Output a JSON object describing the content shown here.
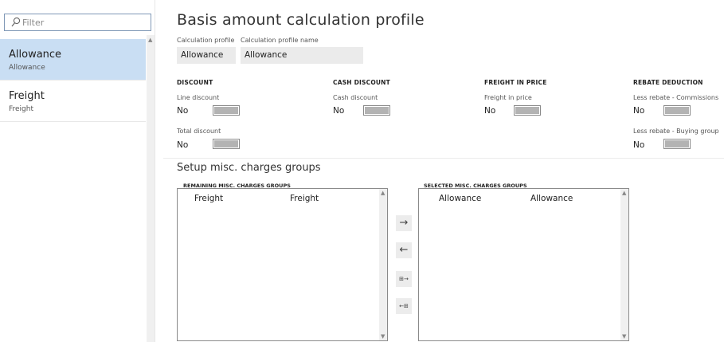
{
  "filter": {
    "placeholder": "Filter",
    "icon": "search-icon"
  },
  "list": [
    {
      "title": "Allowance",
      "subtitle": "Allowance",
      "selected": true
    },
    {
      "title": "Freight",
      "subtitle": "Freight",
      "selected": false
    }
  ],
  "page": {
    "title": "Basis amount calculation profile",
    "fields": {
      "profile_label": "Calculation profile",
      "profile_value": "Allowance",
      "name_label": "Calculation profile name",
      "name_value": "Allowance"
    }
  },
  "sections": {
    "discount": {
      "header": "DISCOUNT",
      "line_label": "Line discount",
      "line_value": "No",
      "total_label": "Total discount",
      "total_value": "No"
    },
    "cash_discount": {
      "header": "CASH DISCOUNT",
      "label": "Cash discount",
      "value": "No"
    },
    "freight": {
      "header": "FREIGHT IN PRICE",
      "label": "Freight in price",
      "value": "No"
    },
    "rebate": {
      "header": "REBATE DEDUCTION",
      "commissions_label": "Less rebate - Commissions",
      "commissions_value": "No",
      "buying_label": "Less rebate - Buying group",
      "buying_value": "No"
    }
  },
  "misc": {
    "title": "Setup misc. charges groups",
    "remaining": {
      "header": "REMAINING MISC. CHARGES GROUPS",
      "rows": [
        [
          "Freight",
          "Freight"
        ]
      ]
    },
    "selected": {
      "header": "SELECTED MISC. CHARGES GROUPS",
      "rows": [
        [
          "Allowance",
          "Allowance"
        ]
      ]
    },
    "buttons": {
      "add": "→",
      "remove": "←",
      "add_all": "⊞→",
      "remove_all": "←⊞"
    }
  },
  "colors": {
    "selected_row": "#c9def3",
    "field_bg": "#ebebeb",
    "toggle_off": "#b3b3b3"
  }
}
